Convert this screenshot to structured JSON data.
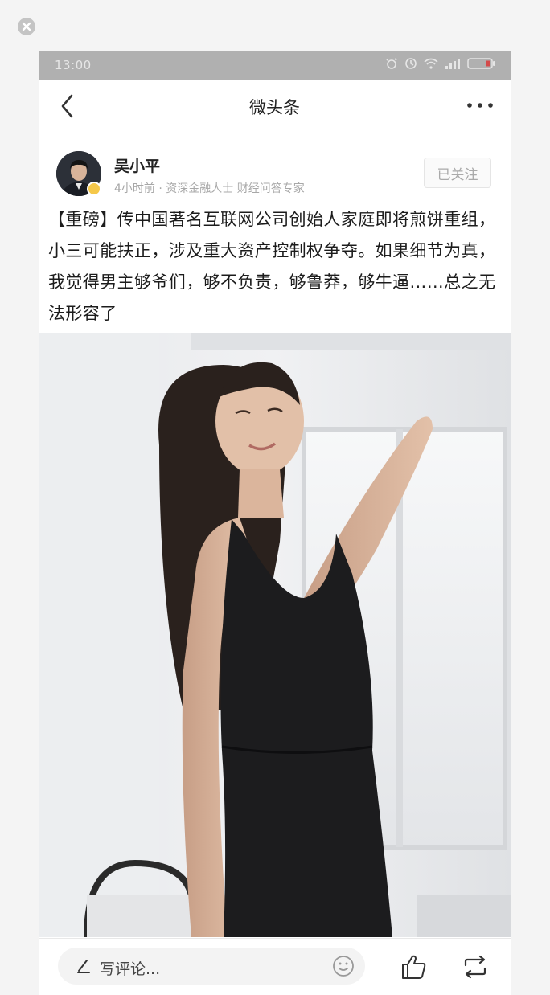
{
  "status_bar": {
    "time": "13:00",
    "icons": [
      "alarm-icon",
      "clock-icon",
      "wifi-icon",
      "signal-icon",
      "battery-icon"
    ]
  },
  "navbar": {
    "title": "微头条",
    "back_icon": "chevron-left-icon",
    "more_icon": "more-dots-icon"
  },
  "author": {
    "name": "吴小平",
    "meta": "4小时前 · 资深金融人士 财经问答专家",
    "follow_label": "已关注",
    "verified_badge_color": "#f5c84a"
  },
  "post": {
    "text": "【重磅】传中国著名互联网公司创始人家庭即将煎饼重组，小三可能扶正，涉及重大资产控制权争夺。如果细节为真，我觉得男主够爷们，够不负责，够鲁莽，够牛逼……总之无法形容了"
  },
  "bottom_bar": {
    "comment_placeholder": "写评论...",
    "icons": [
      "pen-icon",
      "emoji-icon",
      "like-icon",
      "repost-icon"
    ]
  },
  "colors": {
    "status_bar_bg": "#b0b0b0",
    "page_bg": "#f4f4f4",
    "text_primary": "#222222",
    "text_secondary": "#a8a8a8"
  }
}
